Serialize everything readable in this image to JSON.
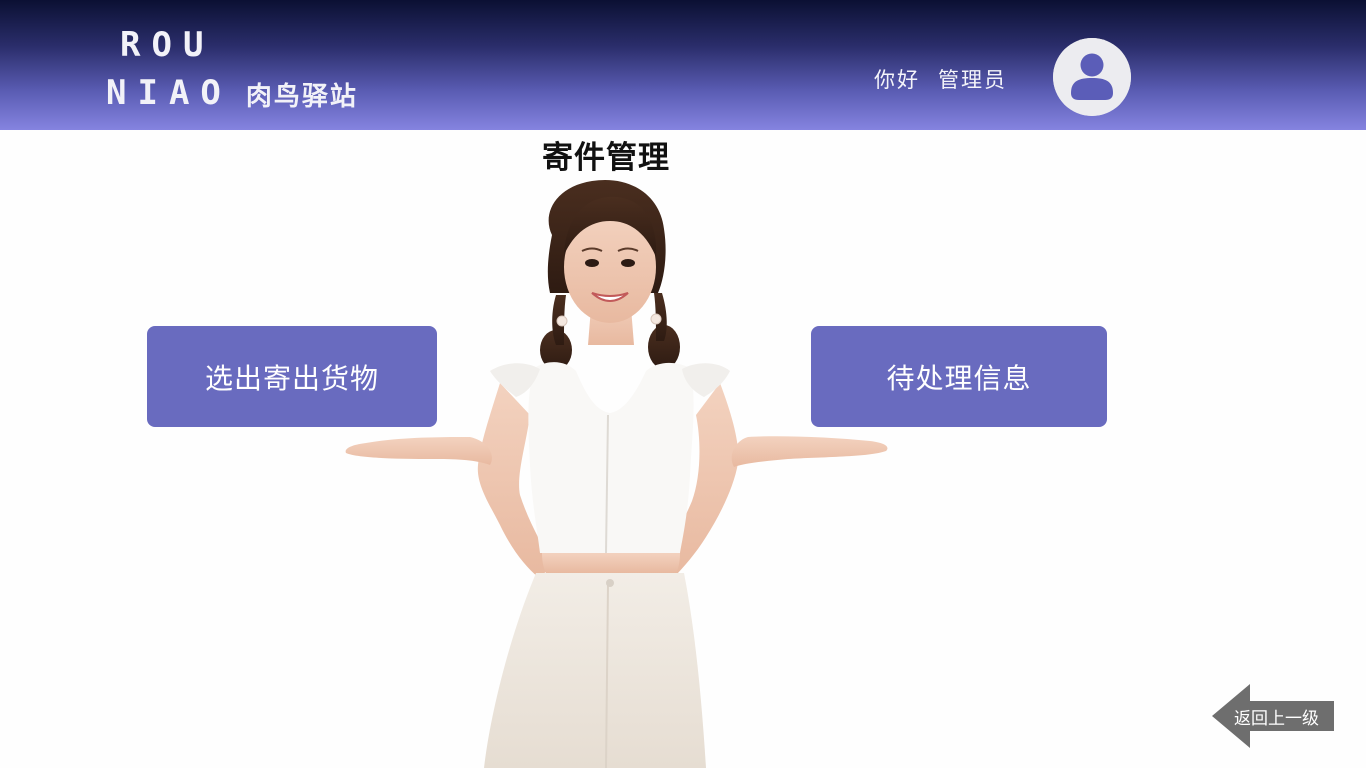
{
  "header": {
    "logo": {
      "line1": "ROU",
      "line2": "NIAO",
      "chinese": "肉鸟驿站"
    },
    "greeting": {
      "hello": "你好",
      "role": "管理员"
    },
    "avatar_icon": "user-icon"
  },
  "main": {
    "title": "寄件管理",
    "illustration": "smiling-woman-presenting",
    "buttons": {
      "left": "选出寄出货物",
      "right": "待处理信息"
    },
    "back": {
      "label": "返回上一级",
      "icon": "arrow-left-icon"
    }
  },
  "colors": {
    "header_top": "#0b1033",
    "header_bottom": "#8583e0",
    "button": "#696bbf",
    "back_arrow": "#6e6e6e",
    "avatar_bg": "#ececf0"
  }
}
